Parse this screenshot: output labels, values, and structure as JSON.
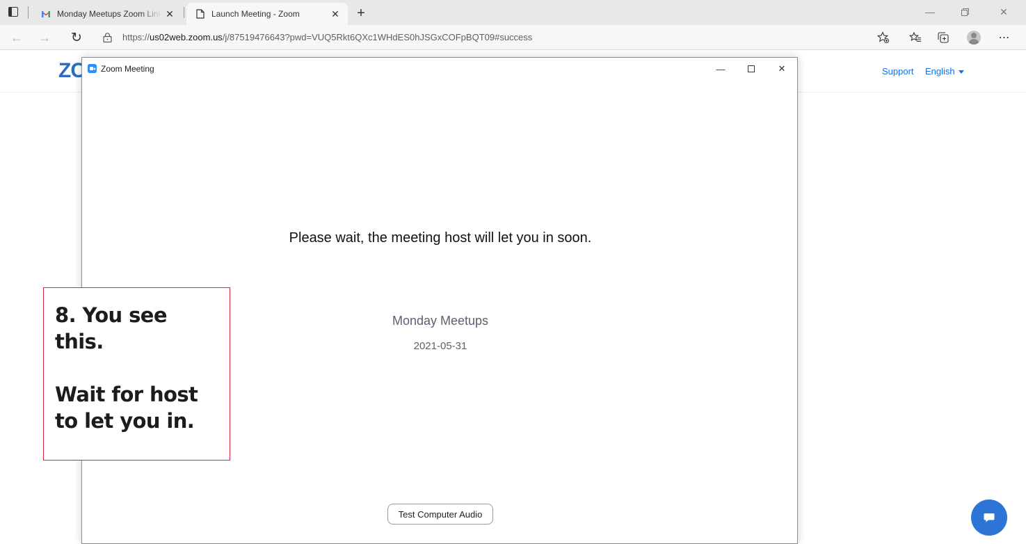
{
  "browser": {
    "tabs": [
      {
        "title": "Monday Meetups Zoom Link - cl",
        "favicon": "gmail-icon",
        "active": false
      },
      {
        "title": "Launch Meeting - Zoom",
        "favicon": "page-icon",
        "active": true
      }
    ],
    "address_bar": {
      "url_prefix": "https://",
      "url_host": "us02web.zoom.us",
      "url_path": "/j/87519476643?pwd=VUQ5Rkt6QXc1WHdES0hJSGxCOFpBQT09#success"
    }
  },
  "page": {
    "logo": "ZC",
    "nav": {
      "support": "Support",
      "language": "English"
    }
  },
  "zoom_window": {
    "title": "Zoom Meeting",
    "wait_message": "Please wait, the meeting host will let you in soon.",
    "meeting_name": "Monday Meetups",
    "meeting_date": "2021-05-31",
    "test_audio_label": "Test Computer Audio"
  },
  "annotation": {
    "line1": "8. You see",
    "line2": "this.",
    "line3": "Wait for host",
    "line4": "to let you in.",
    "border_color": "#d8283a"
  },
  "colors": {
    "zoom_blue": "#2d8cff",
    "link_blue": "#0e72ed",
    "chat_blue": "#2e73d6"
  }
}
